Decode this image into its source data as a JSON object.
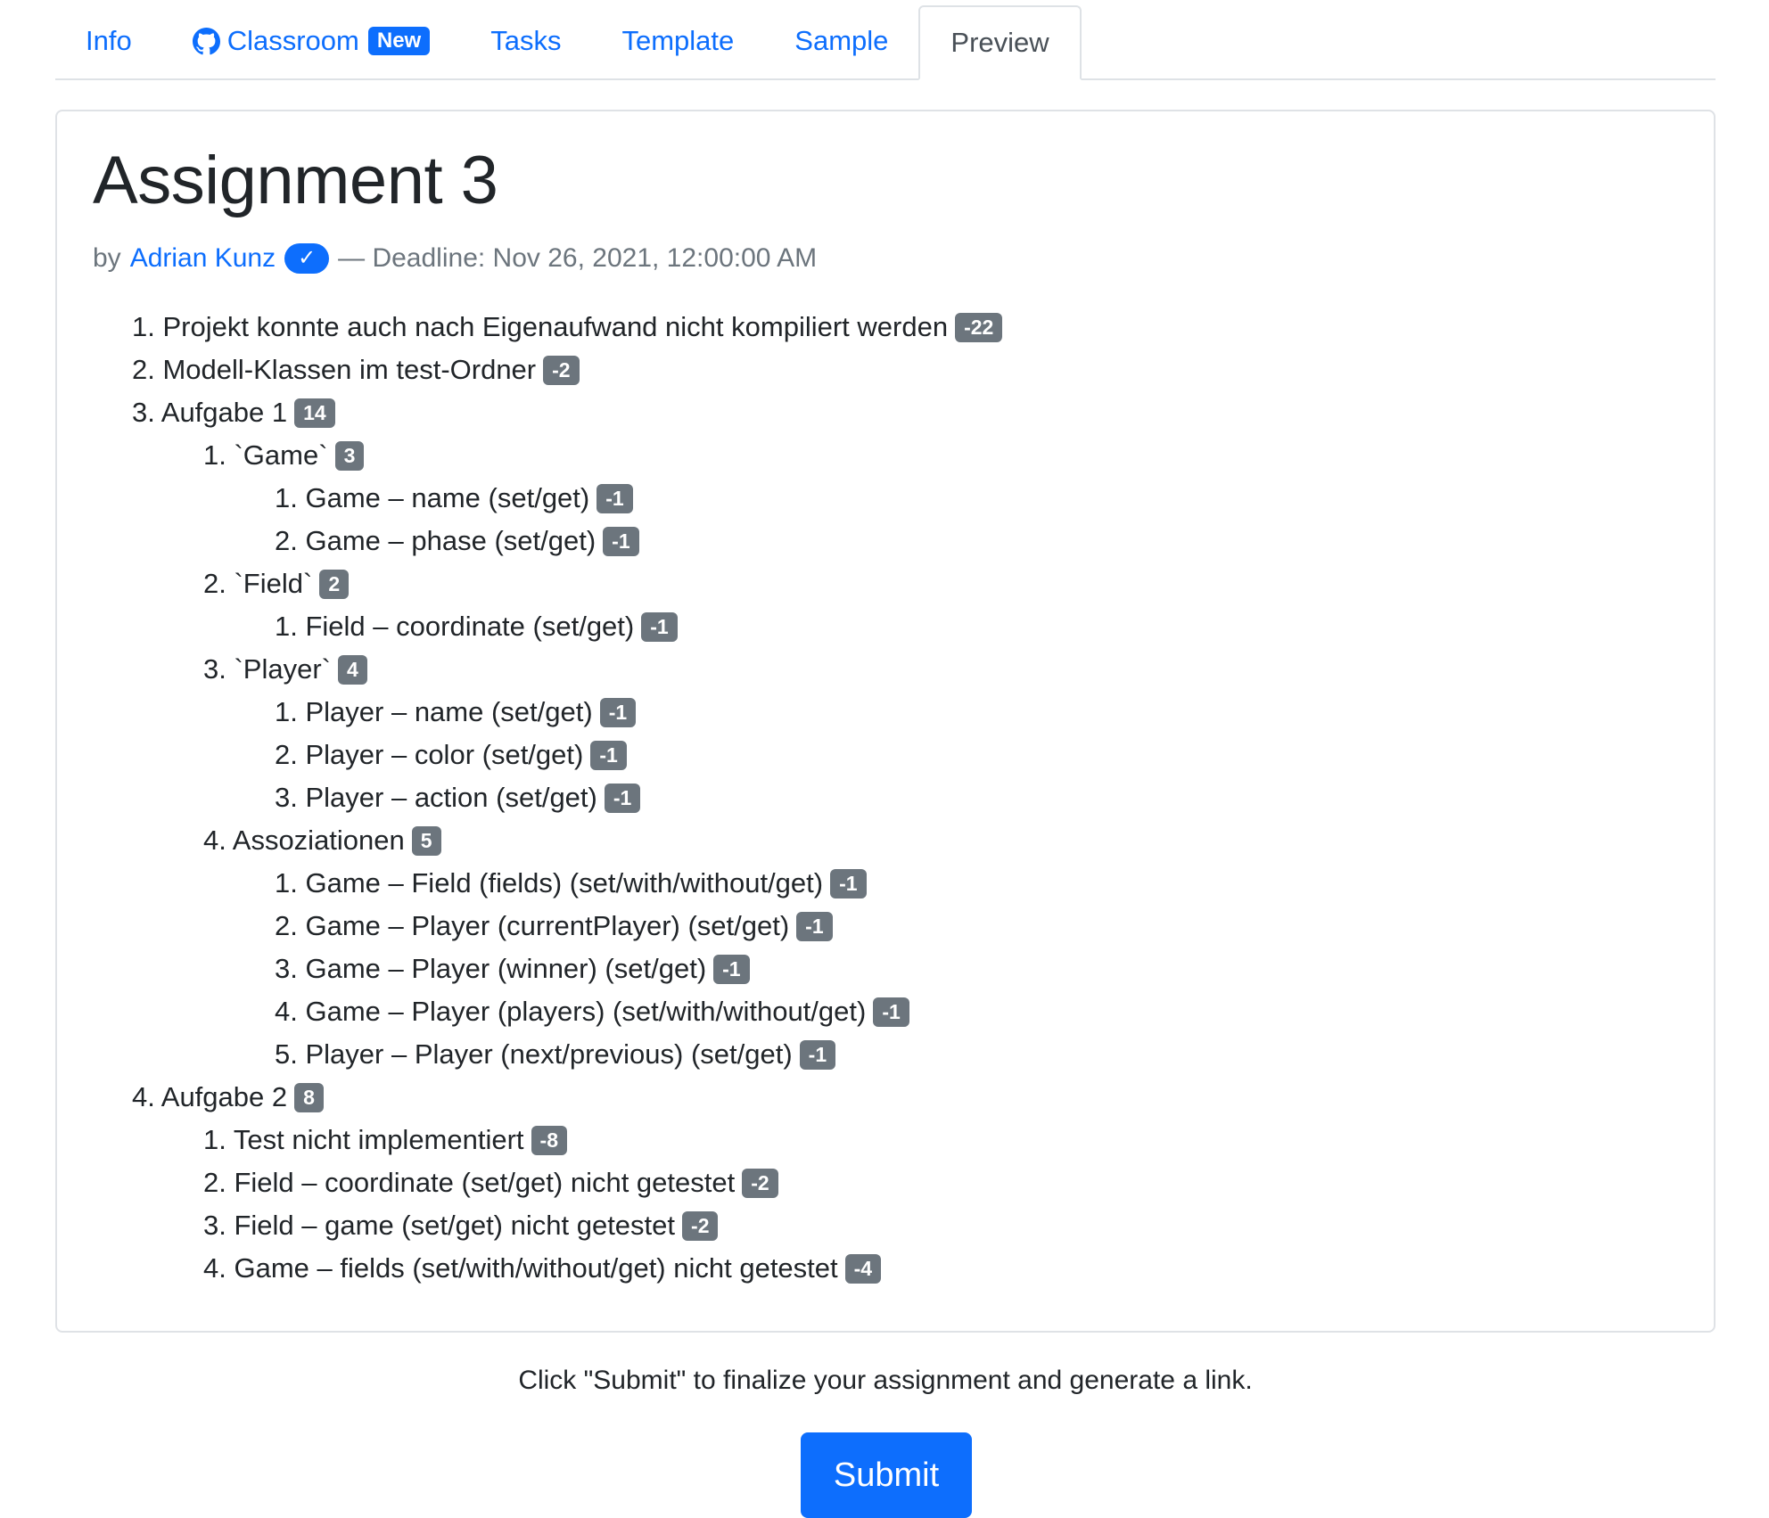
{
  "tabs": {
    "info": "Info",
    "classroom": "Classroom",
    "classroom_badge": "New",
    "tasks": "Tasks",
    "template": "Template",
    "sample": "Sample",
    "preview": "Preview",
    "active": "Preview"
  },
  "assignment": {
    "title": "Assignment 3",
    "by": "by",
    "author": "Adrian Kunz",
    "verified_icon": "check-icon",
    "deadline": "— Deadline: Nov 26, 2021, 12:00:00 AM"
  },
  "tree": [
    {
      "num": "1.",
      "level": 1,
      "text": "Projekt konnte auch nach Eigenaufwand nicht kompiliert werden",
      "points": "-22"
    },
    {
      "num": "2.",
      "level": 1,
      "text": "Modell-Klassen im test-Ordner",
      "points": "-2"
    },
    {
      "num": "3.",
      "level": 1,
      "text": "Aufgabe 1",
      "points": "14"
    },
    {
      "num": "1.",
      "level": 2,
      "text": "`Game`",
      "points": "3"
    },
    {
      "num": "1.",
      "level": 3,
      "text": "Game – name (set/get)",
      "points": "-1"
    },
    {
      "num": "2.",
      "level": 3,
      "text": "Game – phase (set/get)",
      "points": "-1"
    },
    {
      "num": "2.",
      "level": 2,
      "text": "`Field`",
      "points": "2"
    },
    {
      "num": "1.",
      "level": 3,
      "text": "Field – coordinate (set/get)",
      "points": "-1"
    },
    {
      "num": "3.",
      "level": 2,
      "text": "`Player`",
      "points": "4"
    },
    {
      "num": "1.",
      "level": 3,
      "text": "Player – name (set/get)",
      "points": "-1"
    },
    {
      "num": "2.",
      "level": 3,
      "text": "Player – color (set/get)",
      "points": "-1"
    },
    {
      "num": "3.",
      "level": 3,
      "text": "Player – action (set/get)",
      "points": "-1"
    },
    {
      "num": "4.",
      "level": 2,
      "text": "Assoziationen",
      "points": "5"
    },
    {
      "num": "1.",
      "level": 3,
      "text": "Game – Field (fields) (set/with/without/get)",
      "points": "-1"
    },
    {
      "num": "2.",
      "level": 3,
      "text": "Game – Player (currentPlayer) (set/get)",
      "points": "-1"
    },
    {
      "num": "3.",
      "level": 3,
      "text": "Game – Player (winner) (set/get)",
      "points": "-1"
    },
    {
      "num": "4.",
      "level": 3,
      "text": "Game – Player (players) (set/with/without/get)",
      "points": "-1"
    },
    {
      "num": "5.",
      "level": 3,
      "text": "Player – Player (next/previous) (set/get)",
      "points": "-1"
    },
    {
      "num": "4.",
      "level": 1,
      "text": "Aufgabe 2",
      "points": "8"
    },
    {
      "num": "1.",
      "level": 2,
      "text": "Test nicht implementiert",
      "points": "-8"
    },
    {
      "num": "2.",
      "level": 2,
      "text": "Field – coordinate (set/get) nicht getestet",
      "points": "-2"
    },
    {
      "num": "3.",
      "level": 2,
      "text": "Field – game (set/get) nicht getestet",
      "points": "-2"
    },
    {
      "num": "4.",
      "level": 2,
      "text": "Game – fields (set/with/without/get) nicht getestet",
      "points": "-4"
    }
  ],
  "footer": {
    "note": "Click \"Submit\" to finalize your assignment and generate a link.",
    "submit_label": "Submit"
  },
  "colors": {
    "link": "#0d6efd",
    "badge": "#6c757d",
    "primary_button": "#0d6efd"
  }
}
